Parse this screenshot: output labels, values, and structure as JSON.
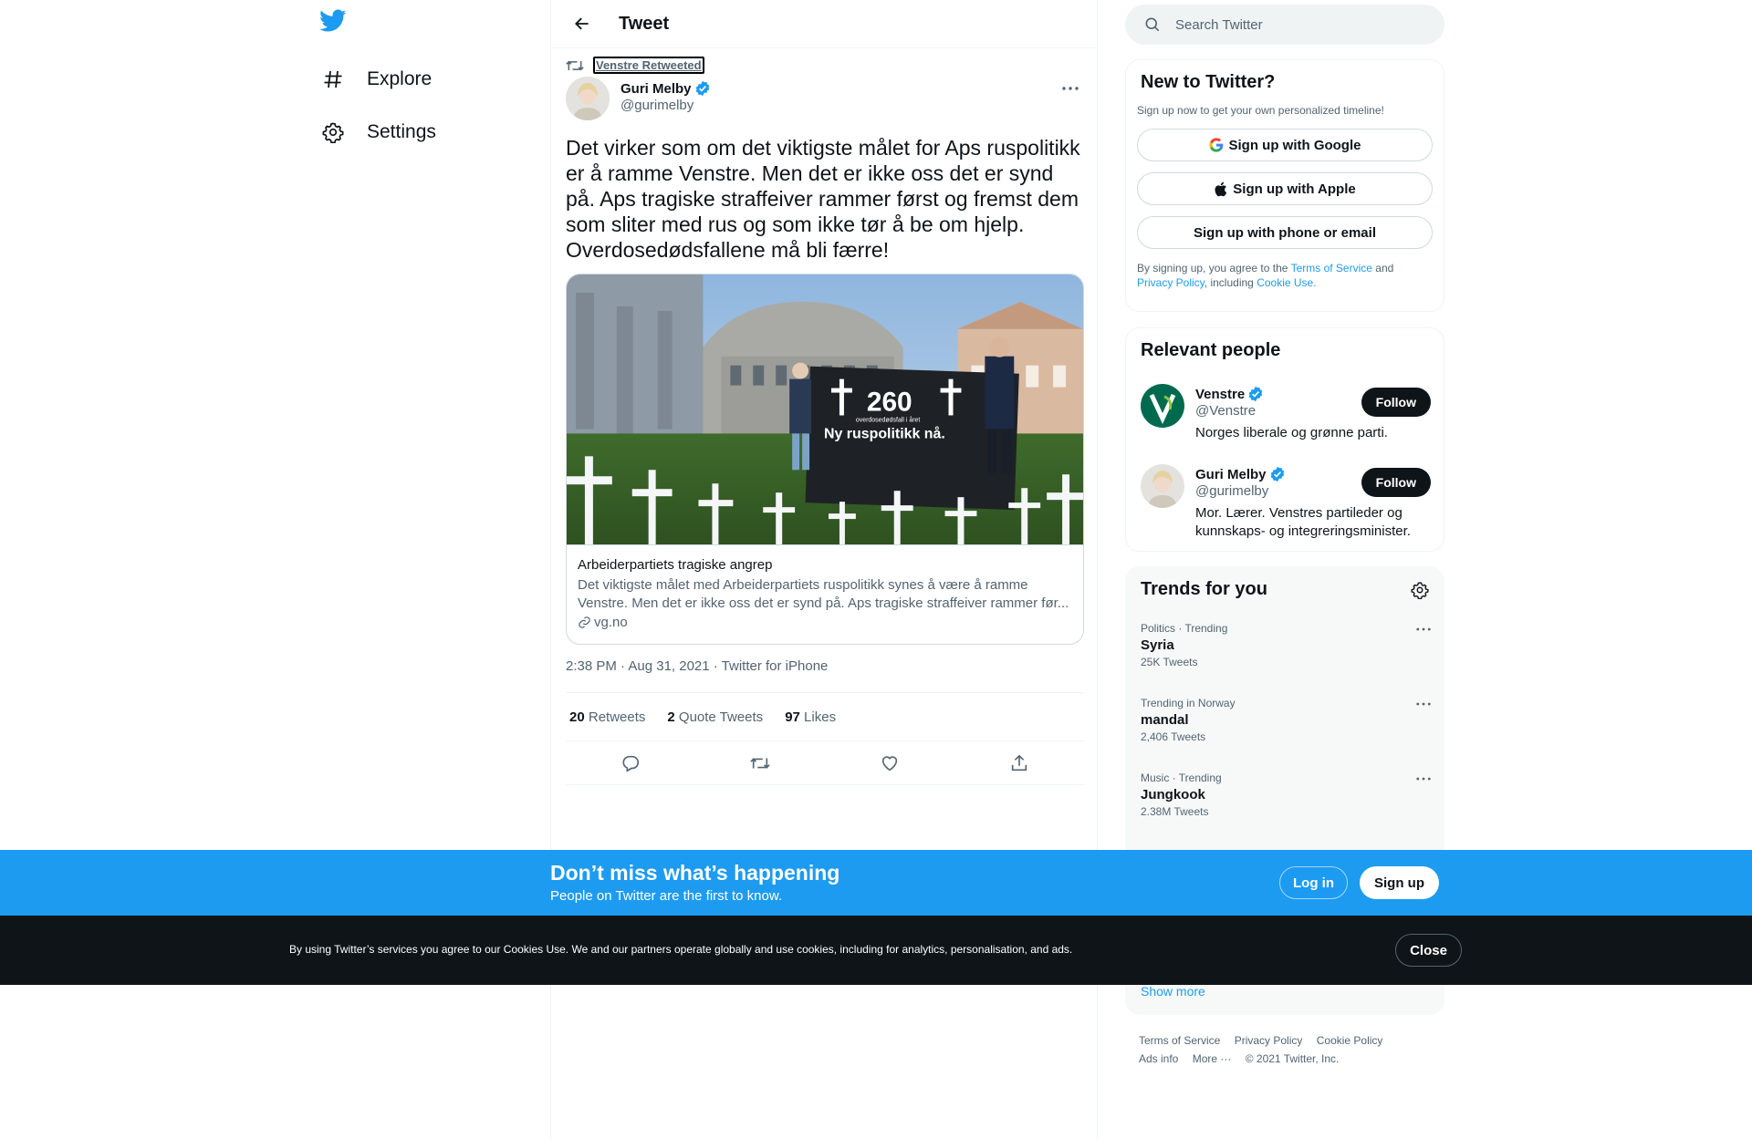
{
  "nav": {
    "logo": "twitter-bird-icon",
    "items": [
      {
        "label": "Explore",
        "icon": "hashtag-icon"
      },
      {
        "label": "Settings",
        "icon": "gear-icon"
      }
    ]
  },
  "header": {
    "title": "Tweet"
  },
  "tweet": {
    "social_context": "Venstre Retweeted",
    "author_name": "Guri Melby",
    "author_handle": "@gurimelby",
    "text": "Det virker som om det viktigste målet for Aps ruspolitikk er å ramme Venstre. Men det er ikke oss det er synd på. Aps tragiske straffeiver rammer først og fremst dem som sliter med rus og som ikke tør å be om hjelp. Overdosedødsfallene må bli færre!",
    "card": {
      "image_banner_number": "260",
      "image_banner_small": "overdosedødsfall i året",
      "image_banner_slogan": "Ny ruspolitikk nå.",
      "title": "Arbeiderpartiets tragiske angrep",
      "description": "Det viktigste målet med Arbeiderpartiets ruspolitikk synes å være å ramme Venstre. Men det er ikke oss det er synd på. Aps tragiske straffeiver rammer før...",
      "domain": "vg.no"
    },
    "meta": "2:38 PM · Aug 31, 2021 · Twitter for iPhone",
    "stats": {
      "retweets_count": "20",
      "retweets_label": "Retweets",
      "quotes_count": "2",
      "quotes_label": "Quote Tweets",
      "likes_count": "97",
      "likes_label": "Likes"
    }
  },
  "search": {
    "placeholder": "Search Twitter"
  },
  "new_to_twitter": {
    "title": "New to Twitter?",
    "subtitle": "Sign up now to get your own personalized timeline!",
    "google": "Sign up with Google",
    "apple": "Sign up with Apple",
    "phone": "Sign up with phone or email",
    "legal_prefix": "By signing up, you agree to the",
    "terms": "Terms of Service",
    "and": "and",
    "privacy": "Privacy Policy",
    "including": ", including",
    "cookie": "Cookie Use."
  },
  "relevant_people": {
    "title": "Relevant people",
    "people": [
      {
        "name": "Venstre",
        "handle": "@Venstre",
        "bio": "Norges liberale og grønne parti.",
        "follow": "Follow"
      },
      {
        "name": "Guri Melby",
        "handle": "@gurimelby",
        "bio": "Mor. Lærer. Venstres partileder og kunnskaps- og integreringsminister.",
        "follow": "Follow"
      }
    ]
  },
  "trends": {
    "title": "Trends for you",
    "items": [
      {
        "category": "Politics · Trending",
        "name": "Syria",
        "count": "25K Tweets"
      },
      {
        "category": "Trending in Norway",
        "name": "mandal",
        "count": "2,406 Tweets"
      },
      {
        "category": "Music · Trending",
        "name": "Jungkook",
        "count": "2.38M Tweets"
      }
    ],
    "show_more": "Show more"
  },
  "footer": {
    "terms": "Terms of Service",
    "privacy": "Privacy Policy",
    "cookie": "Cookie Policy",
    "ads": "Ads info",
    "more": "More ···",
    "copyright": "© 2021 Twitter, Inc."
  },
  "signup_bar": {
    "title": "Don’t miss what’s happening",
    "subtitle": "People on Twitter are the first to know.",
    "login": "Log in",
    "signup": "Sign up"
  },
  "cookie_bar": {
    "text": "By using Twitter’s services you agree to our Cookies Use. We and our partners operate globally and use cookies, including for analytics, personalisation, and ads.",
    "close": "Close"
  },
  "colors": {
    "accent": "#1d9bf0",
    "dark": "#0f1419",
    "muted": "#536471",
    "border": "#eff3f4"
  }
}
